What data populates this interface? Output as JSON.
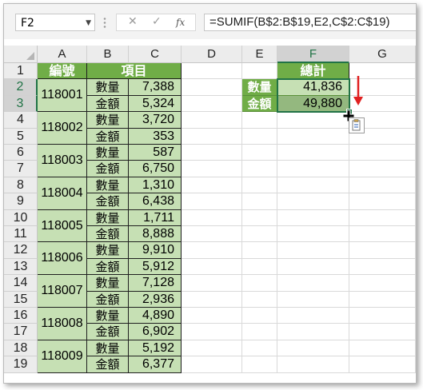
{
  "formula_bar": {
    "name_box": "F2",
    "formula": "=SUMIF(B$2:B$19,E2,C$2:C$19)",
    "cancel_icon": "✕",
    "enter_icon": "✓",
    "fx_label": "fx"
  },
  "columns": [
    "A",
    "B",
    "C",
    "D",
    "E",
    "F",
    "G"
  ],
  "rows": [
    "1",
    "2",
    "3",
    "4",
    "5",
    "6",
    "7",
    "8",
    "9",
    "10",
    "11",
    "12",
    "13",
    "14",
    "15",
    "16",
    "17",
    "18",
    "19"
  ],
  "headers": {
    "a": "編號",
    "bc": "項目",
    "f": "總計"
  },
  "groups": [
    {
      "id": "118001",
      "qty_label": "數量",
      "qty": "7,388",
      "amt_label": "金額",
      "amt": "5,324"
    },
    {
      "id": "118002",
      "qty_label": "數量",
      "qty": "3,720",
      "amt_label": "金額",
      "amt": "353"
    },
    {
      "id": "118003",
      "qty_label": "數量",
      "qty": "587",
      "amt_label": "金額",
      "amt": "6,750"
    },
    {
      "id": "118004",
      "qty_label": "數量",
      "qty": "1,310",
      "amt_label": "金額",
      "amt": "6,438"
    },
    {
      "id": "118005",
      "qty_label": "數量",
      "qty": "1,711",
      "amt_label": "金額",
      "amt": "8,888"
    },
    {
      "id": "118006",
      "qty_label": "數量",
      "qty": "9,910",
      "amt_label": "金額",
      "amt": "5,912"
    },
    {
      "id": "118007",
      "qty_label": "數量",
      "qty": "7,128",
      "amt_label": "金額",
      "amt": "2,936"
    },
    {
      "id": "118008",
      "qty_label": "數量",
      "qty": "4,890",
      "amt_label": "金額",
      "amt": "6,902"
    },
    {
      "id": "118009",
      "qty_label": "數量",
      "qty": "5,192",
      "amt_label": "金額",
      "amt": "6,377"
    }
  ],
  "summary": [
    {
      "label": "數量",
      "value": "41,836"
    },
    {
      "label": "金額",
      "value": "49,880"
    }
  ],
  "colors": {
    "header_green": "#70ad47",
    "light_green": "#c6e0b4",
    "selection": "#217346",
    "arrow": "#e02020"
  },
  "icons": {
    "paste_options": "paste-options-icon",
    "cursor": "fill-cursor-icon",
    "arrow": "down-arrow-icon"
  }
}
